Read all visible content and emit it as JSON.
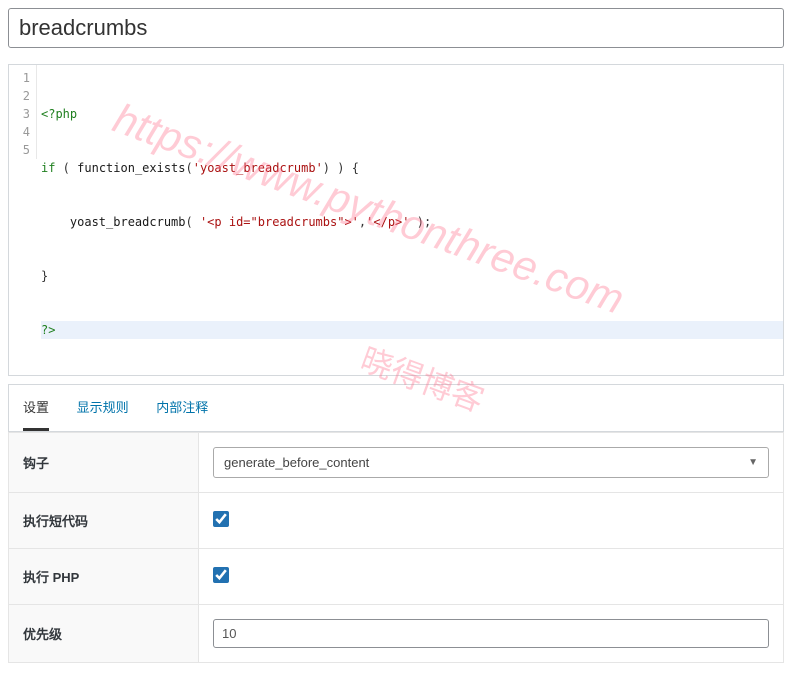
{
  "title_value": "breadcrumbs",
  "code": {
    "gutter": [
      "1",
      "2",
      "3",
      "4",
      "5"
    ],
    "l1_open": "<?php",
    "l2_if": "if",
    "l2_p1": " ( ",
    "l2_fn": "function_exists",
    "l2_p2": "(",
    "l2_str": "'yoast_breadcrumb'",
    "l2_p3": ") ) {",
    "l3_indent": "    ",
    "l3_fn": "yoast_breadcrumb",
    "l3_p1": "( ",
    "l3_str1": "'<p id=\"breadcrumbs\">'",
    "l3_c": ",",
    "l3_str2": "'</p>'",
    "l3_p2": " );",
    "l4": "}",
    "l5": "?>"
  },
  "watermark1": "https://www.pythonthree.com",
  "watermark2": "晓得博客",
  "tabs": {
    "t1": "设置",
    "t2": "显示规则",
    "t3": "内部注释"
  },
  "form": {
    "hook_label": "钩子",
    "hook_value": "generate_before_content",
    "shortcode_label": "执行短代码",
    "php_label": "执行 PHP",
    "priority_label": "优先级",
    "priority_value": "10"
  }
}
